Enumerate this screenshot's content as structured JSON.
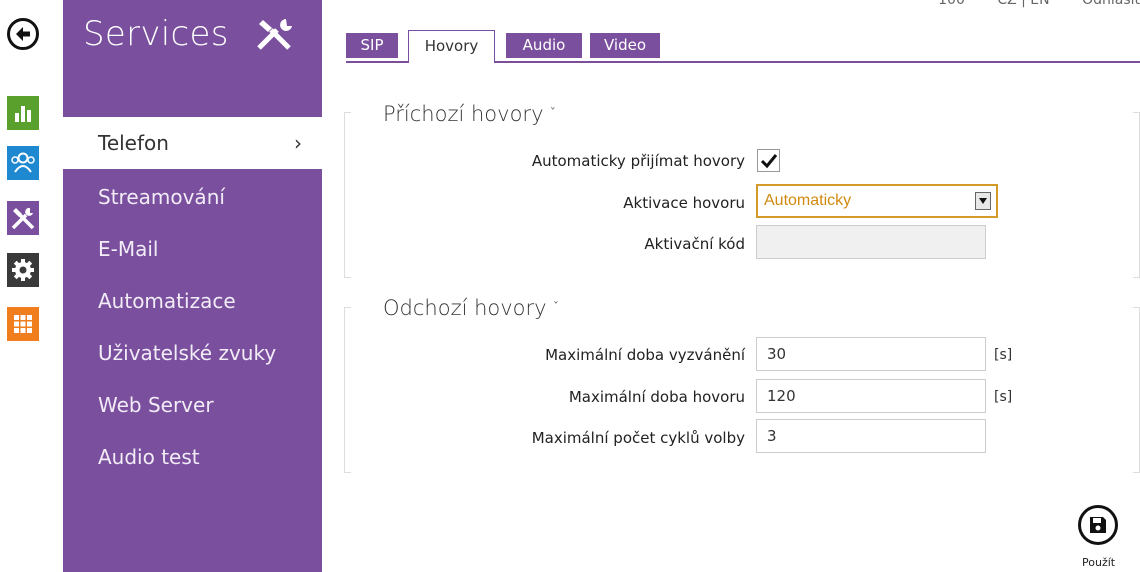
{
  "header": {
    "item1": "100",
    "lang": "CZ | EN",
    "logout": "Odhlásit"
  },
  "sidebar": {
    "title": "Services",
    "items": [
      {
        "label": "Telefon",
        "active": true
      },
      {
        "label": "Streamování"
      },
      {
        "label": "E-Mail"
      },
      {
        "label": "Automatizace"
      },
      {
        "label": "Uživatelské zvuky"
      },
      {
        "label": "Web Server"
      },
      {
        "label": "Audio test"
      }
    ],
    "active_chevron": "›"
  },
  "rail": {
    "icons": [
      "back-arrow-icon",
      "bar-chart-icon",
      "users-icon",
      "tools-icon",
      "gear-icon",
      "grid-icon"
    ],
    "colors": {
      "chart": "#5aa02c",
      "users": "#1e88d0",
      "tools": "#7a4f9e",
      "gear": "#3a3a3a",
      "grid": "#f07e1c"
    }
  },
  "tabs": [
    {
      "label": "SIP"
    },
    {
      "label": "Hovory",
      "active": true
    },
    {
      "label": "Audio"
    },
    {
      "label": "Video"
    }
  ],
  "incoming": {
    "title": "Příchozí hovory",
    "auto_answer_label": "Automaticky přijímat hovory",
    "auto_answer_checked": true,
    "activation_label": "Aktivace hovoru",
    "activation_value": "Automaticky",
    "activation_code_label": "Aktivační kód",
    "activation_code_value": ""
  },
  "outgoing": {
    "title": "Odchozí hovory",
    "ring_time_label": "Maximální doba vyzvánění",
    "ring_time_value": "30",
    "ring_time_unit": "[s]",
    "call_time_label": "Maximální doba hovoru",
    "call_time_value": "120",
    "call_time_unit": "[s]",
    "dial_cycles_label": "Maximální počet cyklů volby",
    "dial_cycles_value": "3"
  },
  "actions": {
    "save_label": "Použít"
  },
  "colors": {
    "accent": "#7a4f9e",
    "select_border": "#d59b2a",
    "select_text": "#d18a10"
  }
}
